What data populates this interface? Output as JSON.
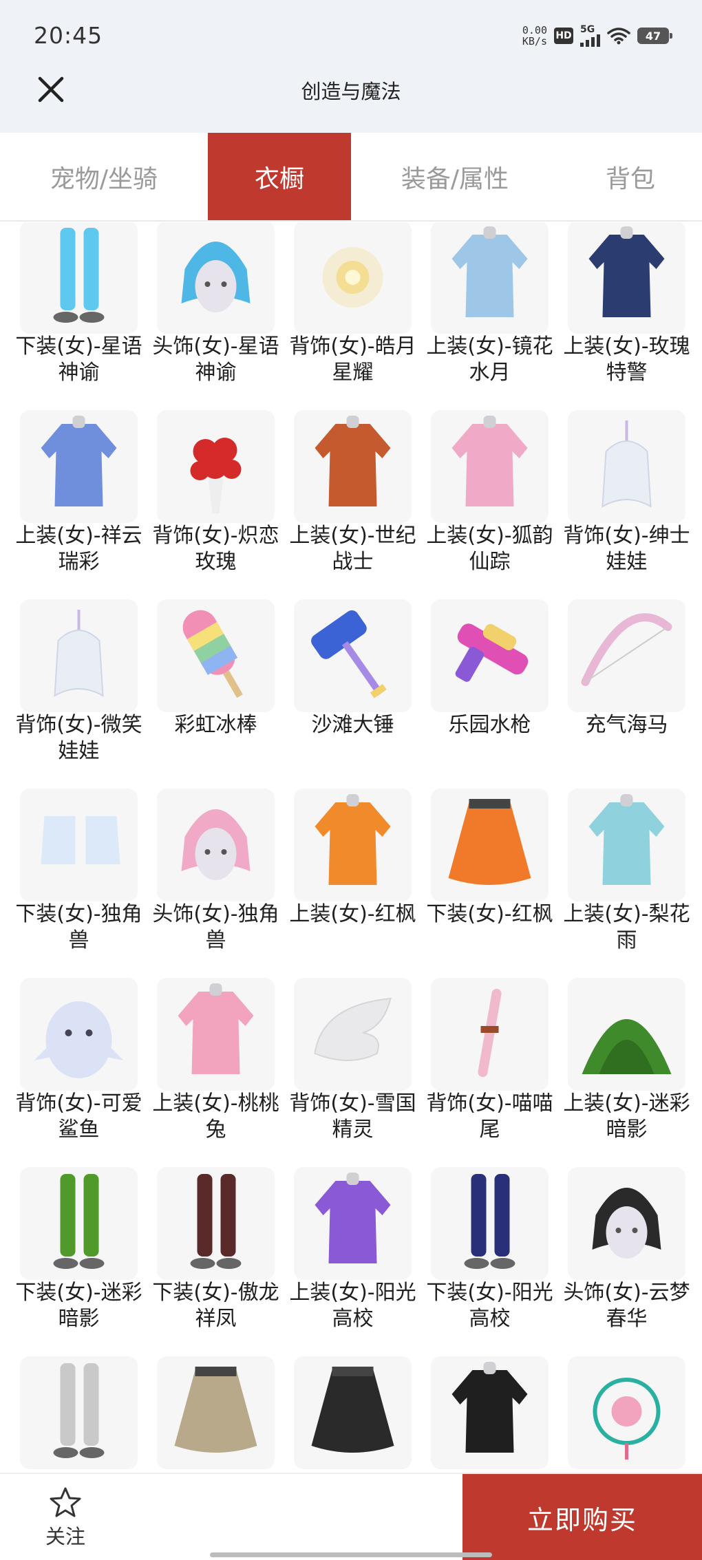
{
  "status_bar": {
    "time": "20:45",
    "net_speed_value": "0.00",
    "net_speed_unit": "KB/s",
    "hd_label": "HD",
    "signal_label": "5G",
    "battery": "47"
  },
  "header": {
    "title": "创造与魔法",
    "close_icon": "close-icon"
  },
  "tabs": [
    {
      "label": "宠物/坐骑",
      "active": false
    },
    {
      "label": "衣橱",
      "active": true
    },
    {
      "label": "装备/属性",
      "active": false
    },
    {
      "label": "背包",
      "active": false
    }
  ],
  "items": [
    {
      "name": "下装(女)-星语神谕",
      "icon": "legs-icon",
      "color": "#5ec8ee"
    },
    {
      "name": "头饰(女)-星语神谕",
      "icon": "head-icon",
      "color": "#4fb7e6"
    },
    {
      "name": "背饰(女)-皓月星耀",
      "icon": "glow-icon",
      "color": "#f2d36b"
    },
    {
      "name": "上装(女)-镜花水月",
      "icon": "top-icon",
      "color": "#9ec6e6"
    },
    {
      "name": "上装(女)-玫瑰特警",
      "icon": "top-icon",
      "color": "#2b3d70"
    },
    {
      "name": "上装(女)-祥云瑞彩",
      "icon": "top-icon",
      "color": "#6f8fdc"
    },
    {
      "name": "背饰(女)-炽恋玫瑰",
      "icon": "bouquet-icon",
      "color": "#d42a2a"
    },
    {
      "name": "上装(女)-世纪战士",
      "icon": "top-icon",
      "color": "#c65a2f"
    },
    {
      "name": "上装(女)-狐韵仙踪",
      "icon": "top-icon",
      "color": "#f0a9c6"
    },
    {
      "name": "背饰(女)-绅士娃娃",
      "icon": "doll-icon",
      "color": "#e9edf4"
    },
    {
      "name": "背饰(女)-微笑娃娃",
      "icon": "doll-icon",
      "color": "#e9edf4"
    },
    {
      "name": "彩虹冰棒",
      "icon": "popsicle-icon",
      "color": "#f28fb4"
    },
    {
      "name": "沙滩大锤",
      "icon": "hammer-icon",
      "color": "#3c63d6"
    },
    {
      "name": "乐园水枪",
      "icon": "watergun-icon",
      "color": "#e04fb3"
    },
    {
      "name": "充气海马",
      "icon": "bow-icon",
      "color": "#e8b7d6"
    },
    {
      "name": "下装(女)-独角兽",
      "icon": "boots-icon",
      "color": "#dbe9f8"
    },
    {
      "name": "头饰(女)-独角兽",
      "icon": "head-icon",
      "color": "#f0a9c6"
    },
    {
      "name": "上装(女)-红枫",
      "icon": "top-icon",
      "color": "#f08a2a"
    },
    {
      "name": "下装(女)-红枫",
      "icon": "skirt-icon",
      "color": "#f07a2a"
    },
    {
      "name": "上装(女)-梨花雨",
      "icon": "top-icon",
      "color": "#8fd1dc"
    },
    {
      "name": "背饰(女)-可爱鲨鱼",
      "icon": "shark-icon",
      "color": "#dbe2f5"
    },
    {
      "name": "上装(女)-桃桃兔",
      "icon": "top-icon",
      "color": "#f2a3bd"
    },
    {
      "name": "背饰(女)-雪国精灵",
      "icon": "wing-icon",
      "color": "#e9e9ec"
    },
    {
      "name": "背饰(女)-喵喵尾",
      "icon": "tail-icon",
      "color": "#f0b9cc"
    },
    {
      "name": "上装(女)-迷彩暗影",
      "icon": "bush-icon",
      "color": "#3f8a2a"
    },
    {
      "name": "下装(女)-迷彩暗影",
      "icon": "legs-icon",
      "color": "#4f9a2a"
    },
    {
      "name": "下装(女)-傲龙祥凤",
      "icon": "legs-icon",
      "color": "#5a2a2a"
    },
    {
      "name": "上装(女)-阳光高校",
      "icon": "top-icon",
      "color": "#8a5ad6"
    },
    {
      "name": "下装(女)-阳光高校",
      "icon": "legs-icon",
      "color": "#2a2f7a"
    },
    {
      "name": "头饰(女)-云梦春华",
      "icon": "head-icon",
      "color": "#2a2a2a"
    },
    {
      "name": "",
      "icon": "legs-icon",
      "color": "#c9c9c9"
    },
    {
      "name": "",
      "icon": "skirt-icon",
      "color": "#b8a98a"
    },
    {
      "name": "",
      "icon": "skirt-icon",
      "color": "#2a2a2a"
    },
    {
      "name": "",
      "icon": "top-icon",
      "color": "#1f1f1f"
    },
    {
      "name": "",
      "icon": "lantern-icon",
      "color": "#2ab0a0"
    }
  ],
  "bottom_bar": {
    "follow_label": "关注",
    "follow_icon": "star-icon",
    "buy_label": "立即购买"
  }
}
